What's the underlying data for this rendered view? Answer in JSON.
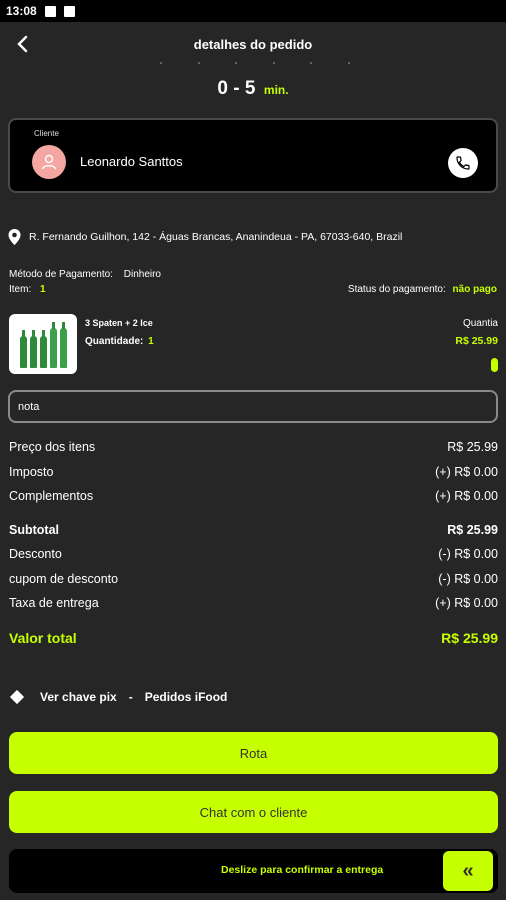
{
  "status_bar": {
    "time": "13:08"
  },
  "header": {
    "title": "detalhes do pedido"
  },
  "eta": {
    "range": "0 - 5",
    "unit": "min."
  },
  "client": {
    "label": "Cliente",
    "name": "Leonardo Santtos"
  },
  "address": "R. Fernando Guilhon, 142 - Águas Brancas, Ananindeua - PA, 67033-640, Brazil",
  "payment": {
    "method_label": "Método de Pagamento:",
    "method_value": "Dinheiro",
    "item_label": "Item:",
    "item_value": "1",
    "status_label": "Status do pagamento:",
    "status_value": "não pago"
  },
  "product": {
    "name": "3 Spaten + 2 Ice",
    "qty_label": "Quantidade:",
    "qty_value": "1",
    "right_label": "Quantia",
    "price": "R$ 25.99"
  },
  "note": {
    "value": "nota"
  },
  "summary": [
    {
      "label": "Preço dos itens",
      "value": "R$ 25.99"
    },
    {
      "label": "Imposto",
      "value": "(+) R$ 0.00"
    },
    {
      "label": "Complementos",
      "value": "(+) R$ 0.00"
    },
    {
      "label": "Subtotal",
      "value": "R$ 25.99"
    },
    {
      "label": "Desconto",
      "value": "(-) R$ 0.00"
    },
    {
      "label": "cupom de desconto",
      "value": "(-) R$ 0.00"
    },
    {
      "label": "Taxa de entrega",
      "value": "(+) R$ 0.00"
    }
  ],
  "total": {
    "label": "Valor total",
    "value": "R$ 25.99"
  },
  "pix": {
    "left": "Ver chave pix",
    "dash": "-",
    "right": "Pedidos iFood"
  },
  "buttons": {
    "route": "Rota",
    "chat": "Chat com o cliente"
  },
  "slider": {
    "text": "Deslize para confirmar a entrega",
    "handle_icon": "«"
  },
  "colors": {
    "accent": "#c6ff00",
    "background": "#262626",
    "card": "#000000"
  }
}
